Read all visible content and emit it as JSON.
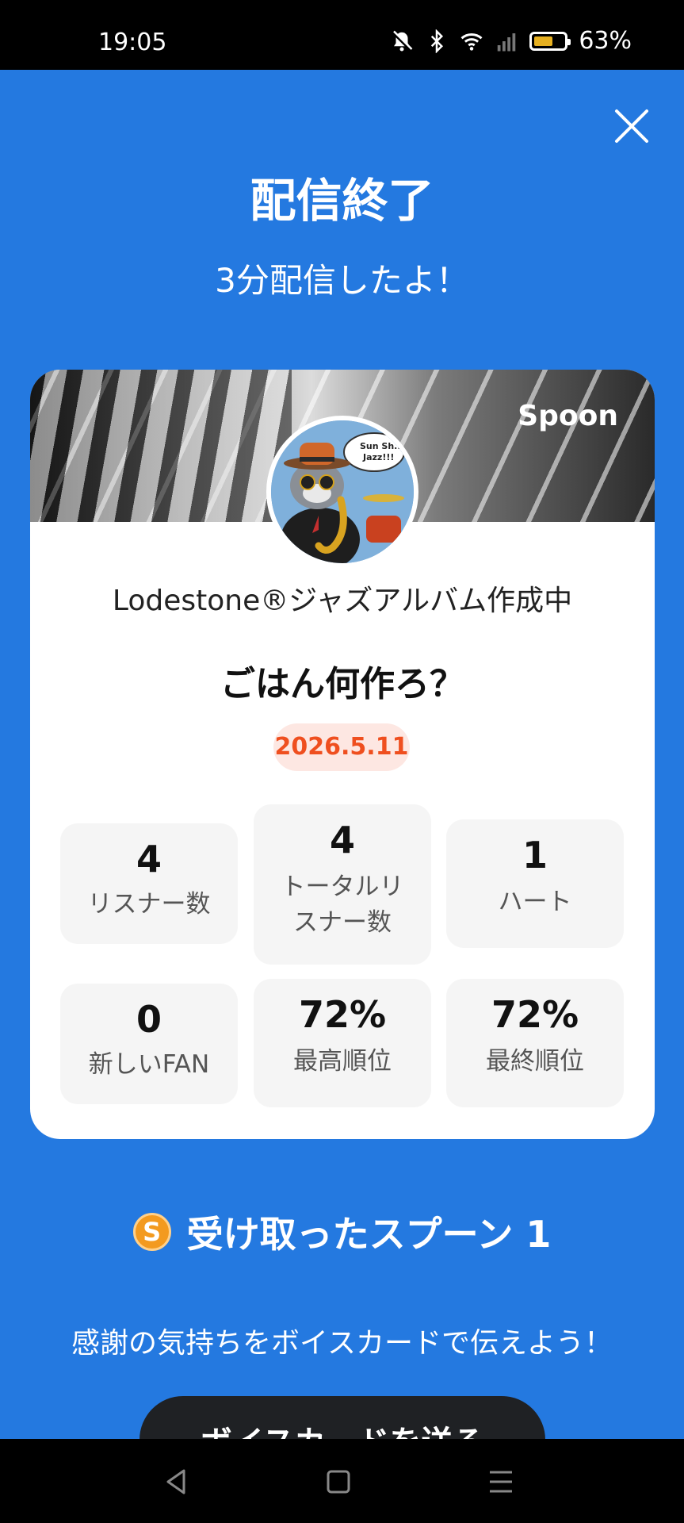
{
  "status_bar": {
    "time": "19:05",
    "battery": "63%",
    "battery_level": 0.63
  },
  "header": {
    "title": "配信終了",
    "subtitle": "3分配信したよ！"
  },
  "card": {
    "brand": "Spoon",
    "avatar_text": "Sun Sh.. Jazz!!!",
    "dj_name": "Lodestone®ジャズアルバム作成中",
    "stream_title": "ごはん何作ろ？",
    "date": "2026.5.11",
    "stats": [
      {
        "value": "4",
        "label": "リスナー数"
      },
      {
        "value": "4",
        "label": "トータルリスナー数"
      },
      {
        "value": "1",
        "label": "ハート"
      },
      {
        "value": "0",
        "label": "新しいFAN"
      },
      {
        "value": "72%",
        "label": "最高順位"
      },
      {
        "value": "72%",
        "label": "最終順位"
      }
    ]
  },
  "spoons": {
    "coin_letter": "S",
    "label": "受け取ったスプーン 1"
  },
  "thanks_text": "感謝の気持ちをボイスカードで伝えよう！",
  "voice_card_button": "ボイスカードを送る",
  "icons": {
    "close": "close-icon",
    "mute": "bell-off-icon",
    "bluetooth": "bluetooth-icon",
    "wifi": "wifi-icon",
    "signal": "signal-icon",
    "nav_back": "back-triangle-icon",
    "nav_home": "home-square-icon",
    "nav_menu": "menu-lines-icon"
  },
  "colors": {
    "background": "#2479e0",
    "date_text": "#ef4f1f",
    "date_bg": "#fde7e2",
    "coin": "#f39a1f"
  }
}
